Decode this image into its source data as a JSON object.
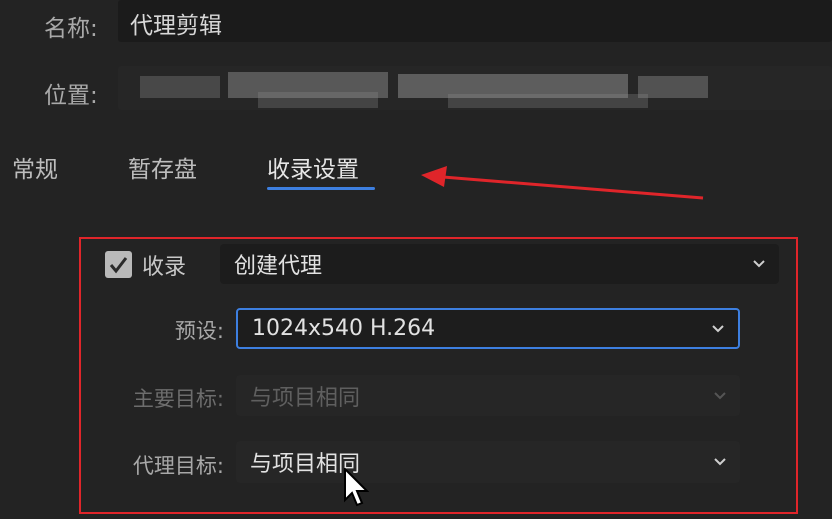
{
  "fields": {
    "name_label": "名称:",
    "name_value": "代理剪辑",
    "location_label": "位置:"
  },
  "tabs": [
    {
      "label": "常规",
      "active": false
    },
    {
      "label": "暂存盘",
      "active": false
    },
    {
      "label": "收录设置",
      "active": true
    }
  ],
  "ingest": {
    "checkbox_label": "收录",
    "checked": true,
    "mode_value": "创建代理",
    "preset_label": "预设:",
    "preset_value": "1024x540 H.264",
    "primary_label": "主要目标:",
    "primary_value": "与项目相同",
    "proxy_label": "代理目标:",
    "proxy_value": "与项目相同"
  },
  "colors": {
    "accent": "#3d7fe0",
    "annotation_red": "#e0252a"
  },
  "icons": [
    "checkbox-check-icon",
    "chevron-down-icon",
    "mouse-cursor-icon",
    "annotation-arrow"
  ]
}
